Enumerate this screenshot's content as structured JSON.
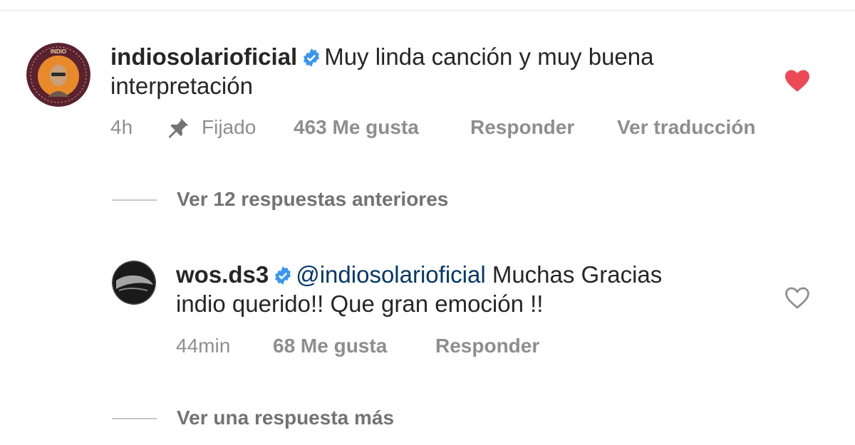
{
  "comment": {
    "username": "indiosolarioficial",
    "text_line1": "Muy linda canción y muy buena",
    "text_line2": "interpretación",
    "time": "4h",
    "pinned_label": "Fijado",
    "likes": "463 Me gusta",
    "reply_label": "Responder",
    "translate_label": "Ver traducción",
    "liked": true,
    "heart_color": "#ed4956",
    "avatar_colors": {
      "ring": "#5a2230",
      "inner": "#e98a2a",
      "text": "INDIO"
    }
  },
  "view_previous_replies": "Ver 12 respuestas anteriores",
  "reply": {
    "username": "wos.ds3",
    "mention": "@indiosolarioficial",
    "text_line1": " Muchas Gracias",
    "text_line2": "indio querido!! Que gran emoción !!",
    "time": "44min",
    "likes": "68 Me gusta",
    "reply_label": "Responder",
    "liked": false
  },
  "view_more_replies": "Ver una respuesta más",
  "colors": {
    "verified": "#3897f0",
    "meta_text": "#8e8e8e",
    "mention": "#00376b"
  }
}
